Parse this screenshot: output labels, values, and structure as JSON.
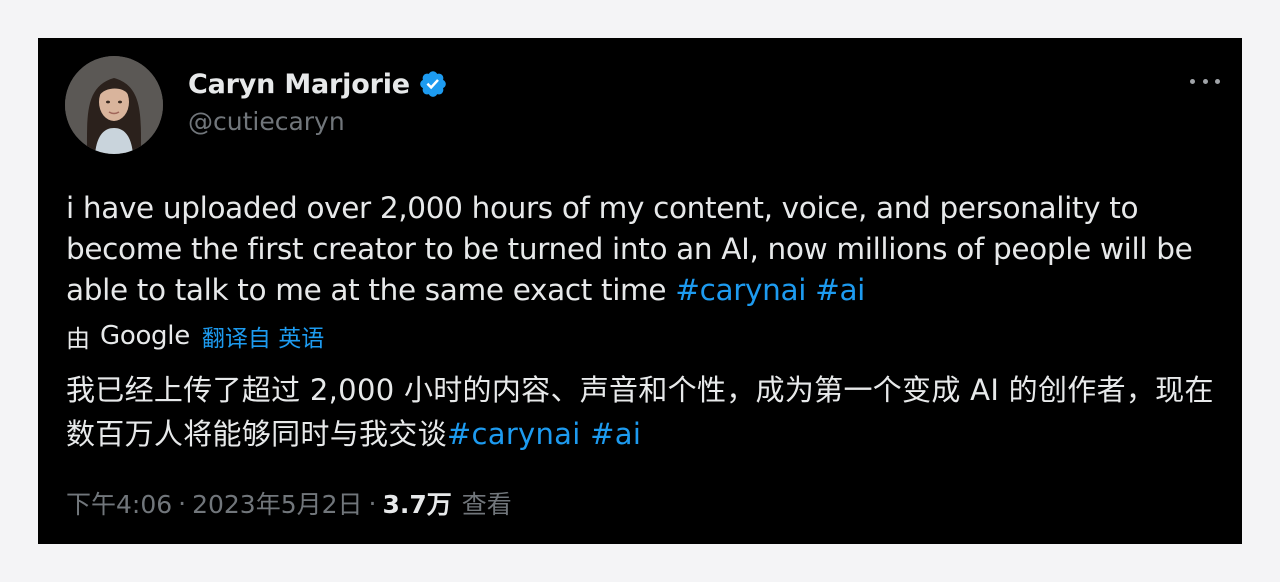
{
  "author": {
    "display_name": "Caryn Marjorie",
    "handle": "@cutiecaryn",
    "verified": true,
    "avatar": "profile-photo"
  },
  "more_icon": "more-horizontal-icon",
  "tweet": {
    "text_parts": [
      "i have uploaded over 2,000 hours of my content, voice, and personality to become the first creator to be turned into an AI, now millions of people will be able to talk to me at the same exact time ",
      "#carynai",
      " ",
      "#ai"
    ]
  },
  "translation": {
    "by_label": "由",
    "provider": "Google",
    "link_label": "翻译自 英语",
    "text_parts": [
      "我已经上传了超过 2,000 小时的内容、声音和个性，成为第一个变成 AI 的创作者，现在数百万人将能够同时与我交谈",
      "#carynai",
      " ",
      "#ai"
    ]
  },
  "meta": {
    "time": "下午4:06",
    "separator": "·",
    "date": "2023年5月2日",
    "views_count": "3.7万",
    "views_label": "查看"
  },
  "colors": {
    "background": "#000000",
    "text": "#e7e9ea",
    "muted": "#71767b",
    "link": "#1d9bf0",
    "verified_badge": "#1d9bf0"
  }
}
